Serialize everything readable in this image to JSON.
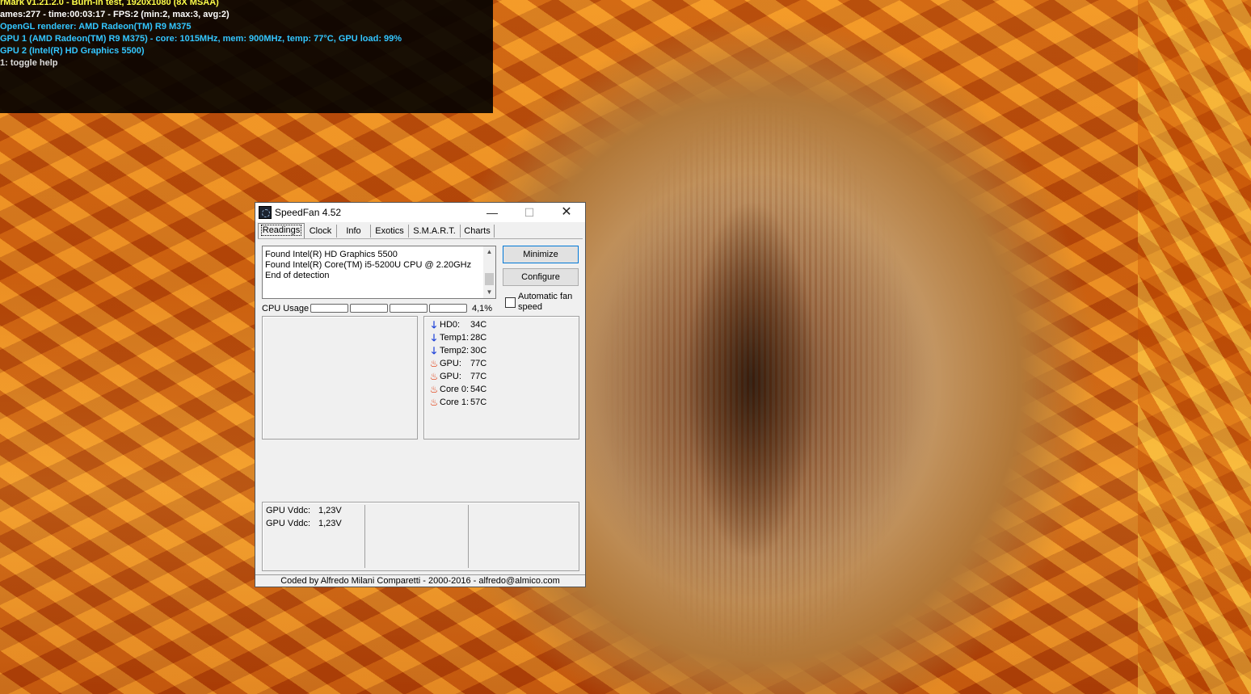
{
  "overlay": {
    "line0": "rMark v1.21.2.0 - Burn-in test, 1920x1080 (8X MSAA)",
    "line1": "ames:277 - time:00:03:17 - FPS:2 (min:2, max:3, avg:2)",
    "line2": "OpenGL renderer: AMD Radeon(TM) R9 M375",
    "line3": "GPU 1 (AMD Radeon(TM) R9 M375) - core: 1015MHz, mem: 900MHz, temp: 77°C, GPU load: 99%",
    "line4": "GPU 2 (Intel(R) HD Graphics 5500)",
    "line5": "1: toggle help"
  },
  "window": {
    "title": "SpeedFan 4.52",
    "minimize_glyph": "—",
    "maximize_glyph": "☐",
    "close_glyph": "✕"
  },
  "tabs": [
    {
      "label": "Readings",
      "active": true
    },
    {
      "label": "Clock"
    },
    {
      "label": "Info"
    },
    {
      "label": "Exotics"
    },
    {
      "label": "S.M.A.R.T."
    },
    {
      "label": "Charts"
    }
  ],
  "log": {
    "lines": [
      "Found Intel(R) HD Graphics 5500",
      "Found Intel(R) Core(TM) i5-5200U CPU @ 2.20GHz",
      "End of detection"
    ]
  },
  "buttons": {
    "minimize": "Minimize",
    "configure": "Configure"
  },
  "auto_fan": {
    "label_line1": "Automatic fan",
    "label_line2": "speed",
    "checked": false
  },
  "cpu_usage": {
    "label": "CPU Usage",
    "value": "4,1%",
    "core_load_fractions": [
      0,
      0,
      0,
      0
    ]
  },
  "temperatures": [
    {
      "name": "HD0:",
      "value": "34C",
      "icon": "arrow-down-icon"
    },
    {
      "name": "Temp1:",
      "value": "28C",
      "icon": "arrow-down-icon"
    },
    {
      "name": "Temp2:",
      "value": "30C",
      "icon": "arrow-down-icon"
    },
    {
      "name": "GPU:",
      "value": "77C",
      "icon": "flame-icon"
    },
    {
      "name": "GPU:",
      "value": "77C",
      "icon": "flame-icon"
    },
    {
      "name": "Core 0:",
      "value": "54C",
      "icon": "flame-icon"
    },
    {
      "name": "Core 1:",
      "value": "57C",
      "icon": "flame-icon"
    }
  ],
  "voltages": [
    {
      "name": "GPU Vddc:",
      "value": "1,23V"
    },
    {
      "name": "GPU Vddc:",
      "value": "1,23V"
    }
  ],
  "status": "Coded by Alfredo Milani Comparetti - 2000-2016 - alfredo@almico.com"
}
